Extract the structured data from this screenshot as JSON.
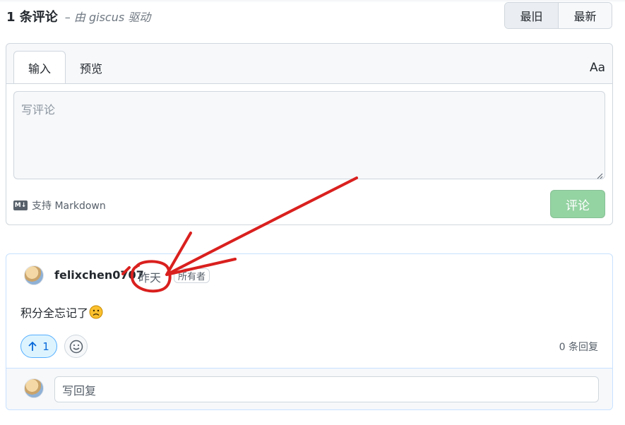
{
  "header": {
    "comment_count": "1 条评论",
    "powered_by": "– 由 giscus 驱动"
  },
  "sort": {
    "oldest": "最旧",
    "newest": "最新"
  },
  "editor": {
    "tab_write": "输入",
    "tab_preview": "预览",
    "format_toggle": "Aa",
    "placeholder": "写评论",
    "markdown_icon": "M↓",
    "markdown_note": "支持 Markdown",
    "submit_label": "评论"
  },
  "comment": {
    "author": "felixchen0707",
    "time": "昨天",
    "badge": "所有者",
    "body": "积分全忘记了",
    "upvotes": "1",
    "upvote_icon": "arrow-up-icon",
    "reaction_icon": "smiley-icon",
    "reply_count": "0 条回复",
    "reply_placeholder": "写回复"
  },
  "colors": {
    "submit_disabled": "#94d3a2",
    "accent_blue": "#0969da",
    "annotation_red": "#d9201e"
  }
}
